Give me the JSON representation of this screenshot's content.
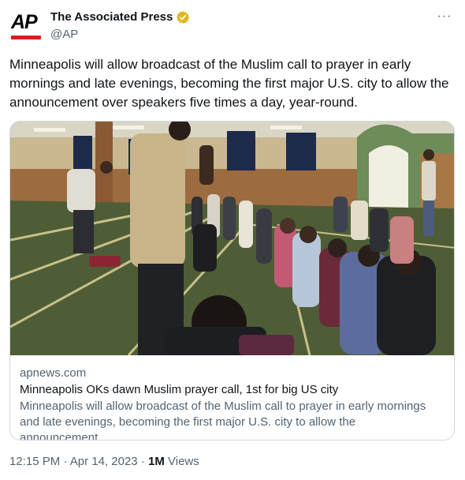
{
  "author": {
    "logo_text": "AP",
    "display_name": "The Associated Press",
    "handle": "@AP",
    "verified_icon": "gold-check-badge"
  },
  "menu": {
    "more_label": "···"
  },
  "tweet": {
    "text": "Minneapolis will allow broadcast of the Muslim call to prayer in early mornings and late evenings, becoming the first major U.S. city to allow the announcement over speakers five times a day, year-round."
  },
  "link_card": {
    "domain": "apnews.com",
    "title": "Minneapolis OKs dawn Muslim prayer call, 1st for big US city",
    "description": "Minneapolis will allow broadcast of the Muslim call to prayer in early mornings and late evenings, becoming the first major U.S. city to allow the announcement…"
  },
  "meta": {
    "time": "12:15 PM",
    "separator": "·",
    "date": "Apr 14, 2023",
    "views_count": "1M",
    "views_label": "Views"
  },
  "colors": {
    "ap_red": "#e01b22",
    "verified_gold": "#e2b719",
    "secondary_text": "#536471",
    "border": "#cfd9de"
  }
}
